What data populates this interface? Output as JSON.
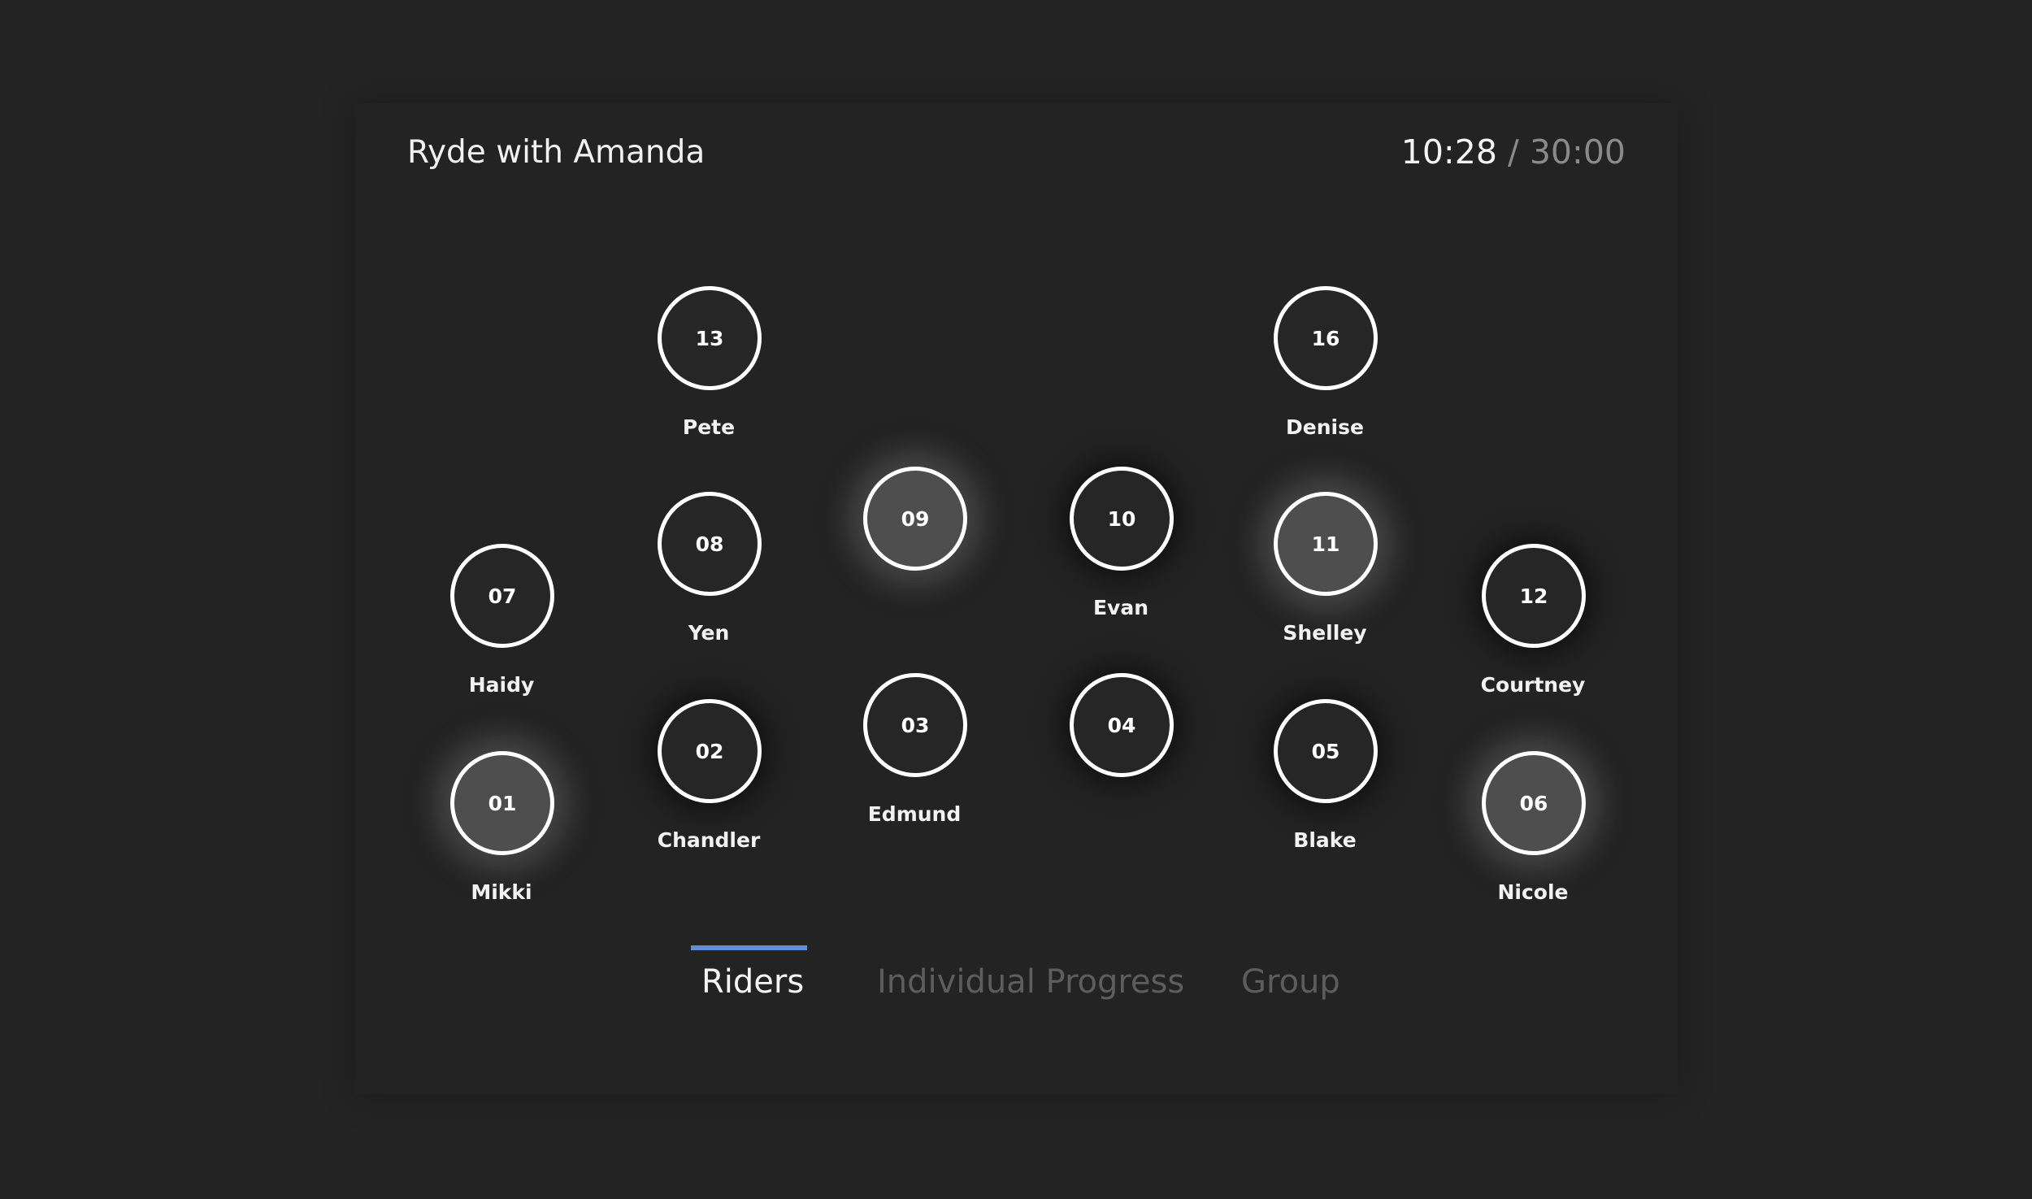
{
  "header": {
    "title": "Ryde with Amanda",
    "timer_elapsed": "10:28",
    "timer_separator": "/",
    "timer_total": "30:00"
  },
  "riders": [
    {
      "number": "13",
      "name": "Pete"
    },
    {
      "number": "16",
      "name": "Denise"
    },
    {
      "number": "09",
      "name": ""
    },
    {
      "number": "10",
      "name": "Evan"
    },
    {
      "number": "08",
      "name": "Yen"
    },
    {
      "number": "11",
      "name": "Shelley"
    },
    {
      "number": "07",
      "name": "Haidy"
    },
    {
      "number": "12",
      "name": "Courtney"
    },
    {
      "number": "03",
      "name": "Edmund"
    },
    {
      "number": "04",
      "name": ""
    },
    {
      "number": "02",
      "name": "Chandler"
    },
    {
      "number": "05",
      "name": "Blake"
    },
    {
      "number": "01",
      "name": "Mikki"
    },
    {
      "number": "06",
      "name": "Nicole"
    }
  ],
  "tabs": [
    {
      "label": "Riders",
      "active": true
    },
    {
      "label": "Individual Progress",
      "active": false
    },
    {
      "label": "Group",
      "active": false
    }
  ],
  "colors": {
    "accent": "#5b8fd6",
    "background": "#242424",
    "text": "#f4f4f4",
    "muted": "#5d5d5d"
  }
}
